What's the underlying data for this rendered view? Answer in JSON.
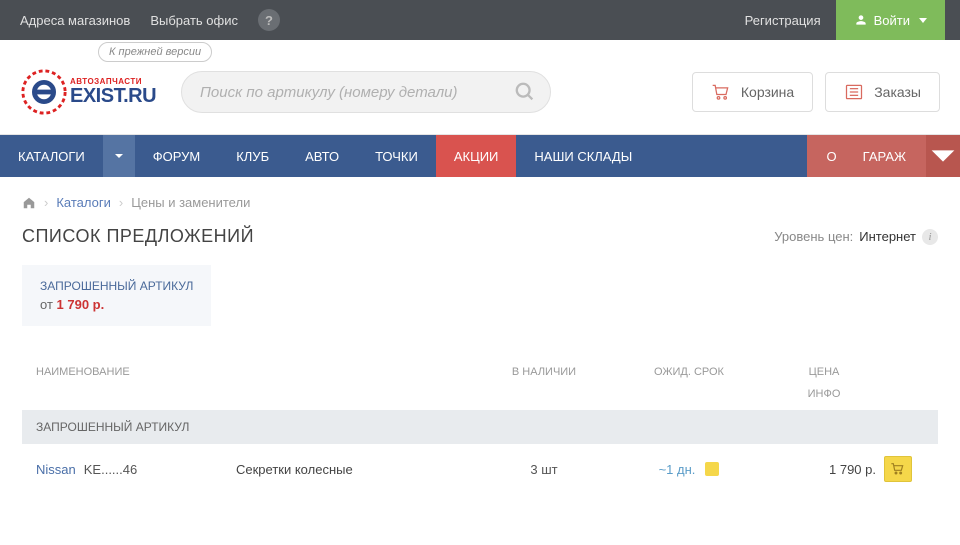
{
  "topbar": {
    "stores": "Адреса магазинов",
    "office": "Выбрать офис",
    "register": "Регистрация",
    "login": "Войти"
  },
  "header": {
    "old_version": "К прежней версии",
    "logo_sub": "АВТОЗАПЧАСТИ",
    "logo_main": "EXIST.RU",
    "search_placeholder": "Поиск по артикулу (номеру детали)",
    "cart": "Корзина",
    "orders": "Заказы"
  },
  "nav": {
    "catalogs": "КАТАЛОГИ",
    "forum": "ФОРУМ",
    "club": "КЛУБ",
    "auto": "АВТО",
    "points": "ТОЧКИ",
    "promo": "АКЦИИ",
    "warehouses": "НАШИ СКЛАДЫ",
    "garage_prefix": "О",
    "garage": "ГАРАЖ"
  },
  "breadcrumb": {
    "catalogs": "Каталоги",
    "current": "Цены и заменители"
  },
  "page": {
    "title": "СПИСОК ПРЕДЛОЖЕНИЙ",
    "price_level_label": "Уровень цен:",
    "price_level_value": "Интернет"
  },
  "requested": {
    "label": "ЗАПРОШЕННЫЙ АРТИКУЛ",
    "from": "от",
    "price": "1 790 р."
  },
  "table": {
    "headers": {
      "name": "НАИМЕНОВАНИЕ",
      "stock": "В НАЛИЧИИ",
      "wait": "ОЖИД. СРОК",
      "price": "ЦЕНА",
      "info": "ИНФО"
    },
    "section": "ЗАПРОШЕННЫЙ АРТИКУЛ",
    "rows": [
      {
        "brand": "Nissan",
        "article": "KE......46",
        "desc": "Секретки колесные",
        "stock": "3 шт",
        "wait": "~1 дн.",
        "price": "1 790 р."
      }
    ]
  }
}
